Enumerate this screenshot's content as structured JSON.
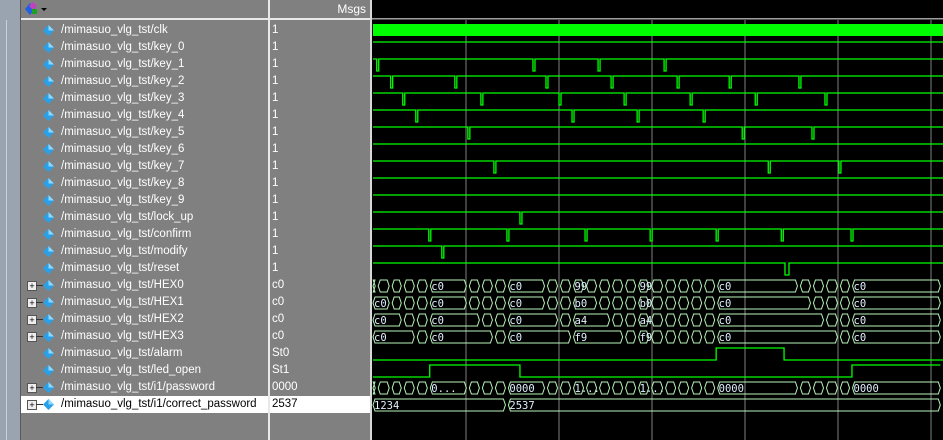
{
  "header": {
    "msgs_label": "Msgs",
    "toolbar_icon": "wave-format-icon"
  },
  "colors": {
    "wave": "#00ff00",
    "bus": "#b8f5b8",
    "grid": "#808080",
    "bus_text": "#e0f0ff"
  },
  "timeline": {
    "end": 610,
    "grid": [
      100,
      200,
      300,
      400,
      500,
      600
    ]
  },
  "signals": [
    {
      "name": "/mimasuo_vlg_tst/clk",
      "value": "1",
      "kind": "clock"
    },
    {
      "name": "/mimasuo_vlg_tst/key_0",
      "value": "1",
      "kind": "bit",
      "dips": []
    },
    {
      "name": "/mimasuo_vlg_tst/key_1",
      "value": "1",
      "kind": "bit",
      "dips": [
        4,
        172,
        242,
        313
      ]
    },
    {
      "name": "/mimasuo_vlg_tst/key_2",
      "value": "1",
      "kind": "bit",
      "dips": [
        19,
        88,
        186,
        256,
        327,
        383,
        458
      ]
    },
    {
      "name": "/mimasuo_vlg_tst/key_3",
      "value": "1",
      "kind": "bit",
      "dips": [
        32,
        116,
        200,
        270,
        341,
        411,
        486
      ]
    },
    {
      "name": "/mimasuo_vlg_tst/key_4",
      "value": "1",
      "kind": "bit",
      "dips": [
        46,
        214,
        284,
        355
      ]
    },
    {
      "name": "/mimasuo_vlg_tst/key_5",
      "value": "1",
      "kind": "bit",
      "dips": [
        102,
        397,
        472
      ]
    },
    {
      "name": "/mimasuo_vlg_tst/key_6",
      "value": "1",
      "kind": "bit",
      "dips": []
    },
    {
      "name": "/mimasuo_vlg_tst/key_7",
      "value": "1",
      "kind": "bit",
      "dips": [
        130,
        425,
        501
      ]
    },
    {
      "name": "/mimasuo_vlg_tst/key_8",
      "value": "1",
      "kind": "bit",
      "dips": []
    },
    {
      "name": "/mimasuo_vlg_tst/key_9",
      "value": "1",
      "kind": "bit",
      "dips": []
    },
    {
      "name": "/mimasuo_vlg_tst/lock_up",
      "value": "1",
      "kind": "bit",
      "dips": [
        158
      ]
    },
    {
      "name": "/mimasuo_vlg_tst/confirm",
      "value": "1",
      "kind": "bit",
      "dips": [
        60,
        144,
        228,
        298,
        369,
        439,
        514
      ]
    },
    {
      "name": "/mimasuo_vlg_tst/modify",
      "value": "1",
      "kind": "bit",
      "dips": [
        74
      ]
    },
    {
      "name": "/mimasuo_vlg_tst/reset",
      "value": "1",
      "kind": "bit",
      "dips": [
        443
      ],
      "dip_width": 4
    },
    {
      "name": "/mimasuo_vlg_tst/HEX0",
      "value": "c0",
      "kind": "bus",
      "edges": [
        4,
        19,
        32,
        46,
        60,
        102,
        116,
        130,
        144,
        186,
        200,
        214,
        228,
        242,
        256,
        270,
        284,
        298,
        313,
        327,
        341,
        355,
        369,
        458,
        472,
        486,
        501,
        514
      ],
      "labels": {
        "60": "c0",
        "144": "c0",
        "214": "99",
        "284": "99",
        "369": "c0",
        "514": "c0"
      }
    },
    {
      "name": "/mimasuo_vlg_tst/HEX1",
      "value": "c0",
      "kind": "bus",
      "edges": [
        19,
        32,
        46,
        60,
        102,
        116,
        130,
        144,
        186,
        200,
        214,
        242,
        256,
        270,
        284,
        298,
        313,
        327,
        341,
        355,
        369,
        472,
        486,
        501,
        514
      ],
      "labels": {
        "0": "c0",
        "60": "c0",
        "144": "c0",
        "214": "b0",
        "284": "b0",
        "369": "c0",
        "514": "c0"
      }
    },
    {
      "name": "/mimasuo_vlg_tst/HEX2",
      "value": "c0",
      "kind": "bus",
      "edges": [
        32,
        46,
        60,
        116,
        130,
        144,
        200,
        214,
        256,
        270,
        284,
        298,
        313,
        327,
        341,
        355,
        369,
        486,
        501,
        514
      ],
      "labels": {
        "0": "c0",
        "60": "c0",
        "144": "c0",
        "214": "a4",
        "284": "a4",
        "369": "c0",
        "514": "c0"
      }
    },
    {
      "name": "/mimasuo_vlg_tst/HEX3",
      "value": "c0",
      "kind": "bus",
      "edges": [
        46,
        60,
        130,
        144,
        214,
        270,
        284,
        298,
        313,
        327,
        341,
        355,
        369,
        501,
        514
      ],
      "labels": {
        "0": "c0",
        "60": "c0",
        "144": "c0",
        "214": "f9",
        "284": "f9",
        "369": "c0",
        "514": "c0"
      }
    },
    {
      "name": "/mimasuo_vlg_tst/alarm",
      "value": "St0",
      "kind": "level",
      "start": 0,
      "highs": [
        [
          369,
          442
        ]
      ]
    },
    {
      "name": "/mimasuo_vlg_tst/led_open",
      "value": "St1",
      "kind": "level",
      "start": 0,
      "highs": [
        [
          61,
          158
        ],
        [
          515,
          610
        ]
      ]
    },
    {
      "name": "/mimasuo_vlg_tst/i1/password",
      "value": "0000",
      "kind": "bus",
      "edges": [
        4,
        19,
        32,
        46,
        60,
        102,
        116,
        130,
        144,
        186,
        200,
        214,
        228,
        242,
        256,
        270,
        284,
        298,
        313,
        327,
        341,
        355,
        369,
        458,
        472,
        486,
        501,
        514
      ],
      "labels": {
        "60": "0...",
        "144": "0000",
        "214": "1...",
        "284": "1...",
        "369": "0000",
        "514": "0000"
      }
    },
    {
      "name": "/mimasuo_vlg_tst/i1/correct_password",
      "value": "2537",
      "kind": "bus",
      "selected": true,
      "edges": [
        144
      ],
      "labels": {
        "0": "1234",
        "144": "2537"
      }
    }
  ]
}
